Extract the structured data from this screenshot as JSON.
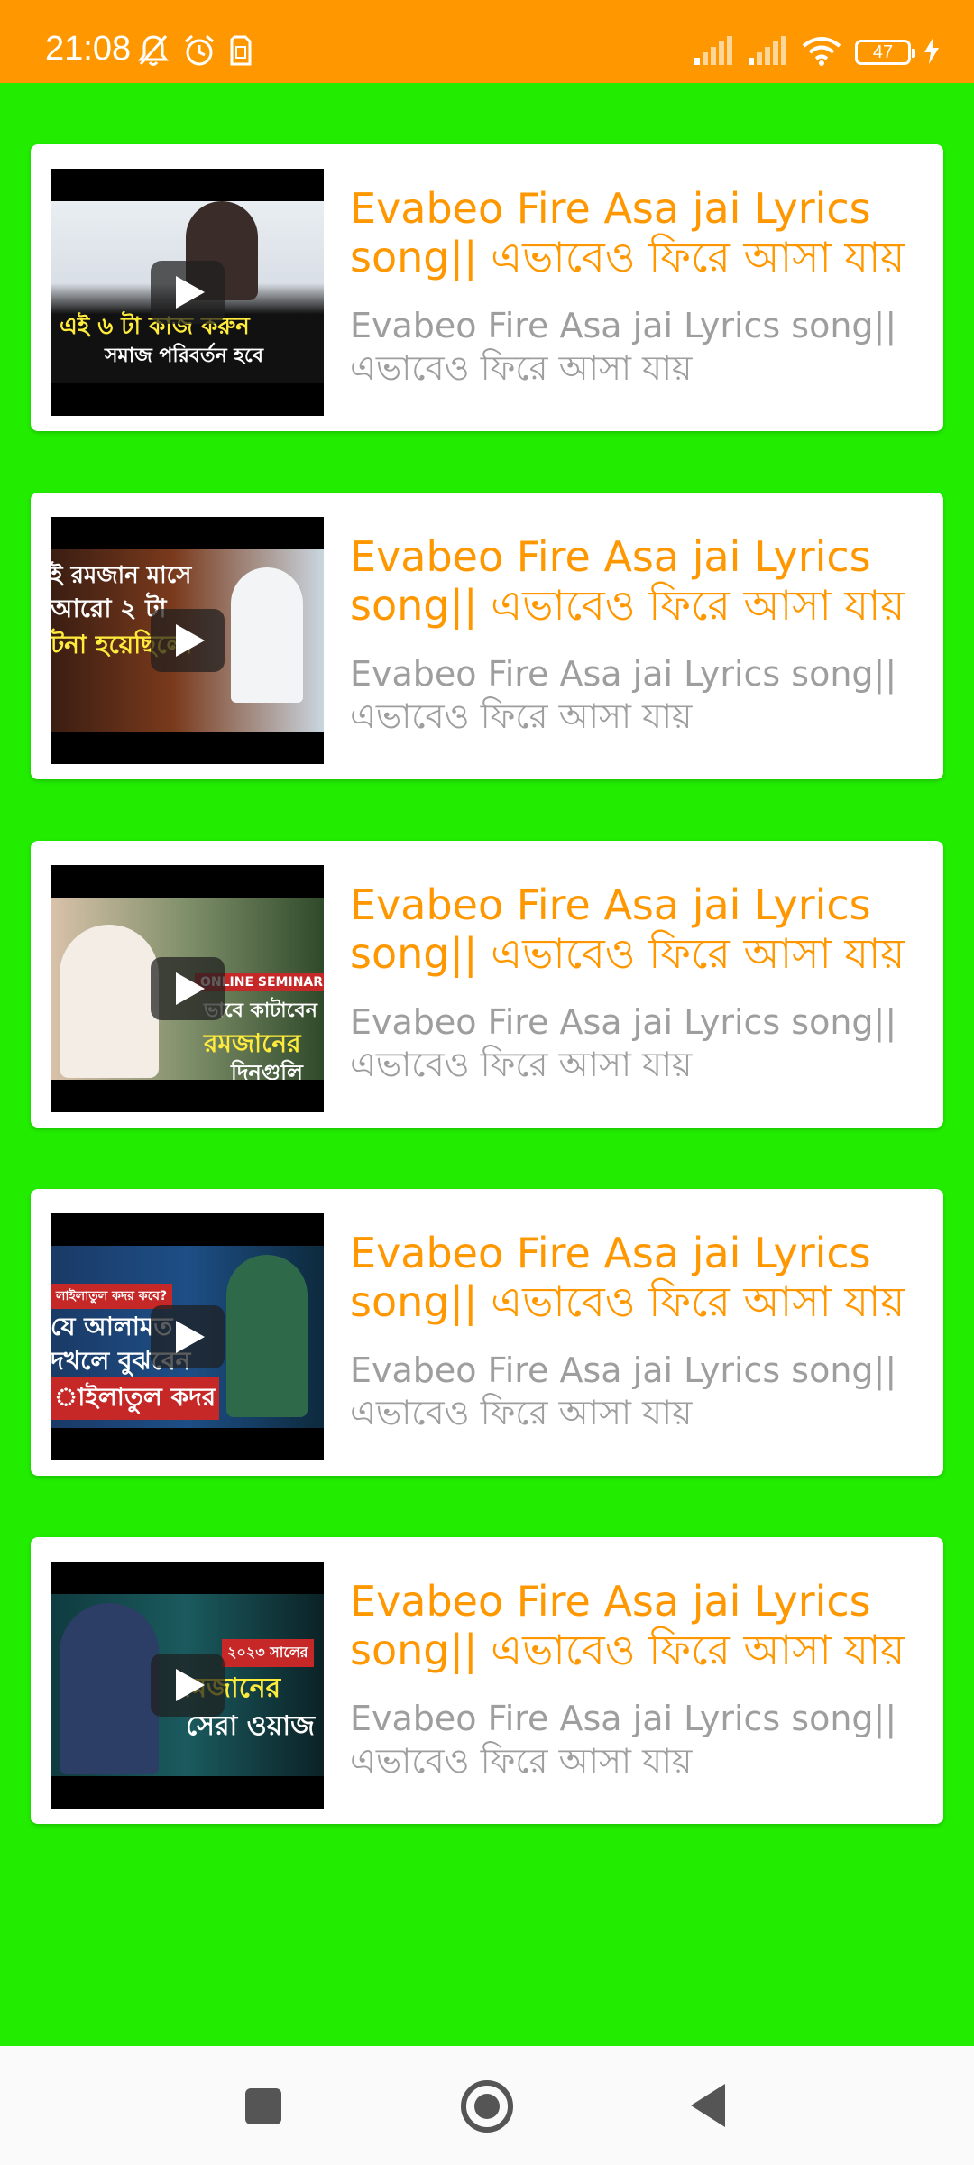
{
  "status_bar": {
    "time": "21:08",
    "battery_level": "47",
    "left_icons": [
      "muted-bell-icon",
      "alarm-clock-icon",
      "sim-icon"
    ],
    "right_icons": [
      "signal-icon",
      "signal-icon",
      "wifi-icon",
      "battery-icon",
      "charging-bolt-icon"
    ]
  },
  "colors": {
    "status_bar": "#ff9800",
    "background": "#22ec00",
    "title_text": "#ff9800",
    "subtitle_text": "#9e9e9e"
  },
  "list": {
    "items": [
      {
        "title": "Evabeo Fire Asa jai Lyrics song|| এভাবেও ফিরে আসা যায়",
        "subtitle": "Evabeo Fire Asa jai Lyrics song|| এভাবেও ফিরে আসা যায়",
        "thumbnail_lines": [
          "এই ৬ টা কাজ করুন",
          "সমাজ পরিবর্তন হবে"
        ]
      },
      {
        "title": "Evabeo Fire Asa jai Lyrics song|| এভাবেও ফিরে আসা যায়",
        "subtitle": "Evabeo Fire Asa jai Lyrics song|| এভাবেও ফিরে আসা যায়",
        "thumbnail_lines": [
          "ই রমজান মাসে",
          "আরো ২ টা",
          "টনা হয়েছিলো"
        ]
      },
      {
        "title": "Evabeo Fire Asa jai Lyrics song|| এভাবেও ফিরে আসা যায়",
        "subtitle": "Evabeo Fire Asa jai Lyrics song|| এভাবেও ফিরে আসা যায়",
        "thumbnail_lines": [
          "ONLINE SEMINAR",
          "ভাবে কাটাবেন",
          "রমজানের",
          "দিনগুলি"
        ]
      },
      {
        "title": "Evabeo Fire Asa jai Lyrics song|| এভাবেও ফিরে আসা যায়",
        "subtitle": "Evabeo Fire Asa jai Lyrics song|| এভাবেও ফিরে আসা যায়",
        "thumbnail_lines": [
          "লাইলাতুল কদর কবে?",
          "যে আলামত",
          "দখলে বুঝবেন",
          "াইলাতুল কদর"
        ]
      },
      {
        "title": "Evabeo Fire Asa jai Lyrics song|| এভাবেও ফিরে আসা যায়",
        "subtitle": "Evabeo Fire Asa jai Lyrics song|| এভাবেও ফিরে আসা যায়",
        "thumbnail_lines": [
          "২০২৩ সালের",
          "রমজানের",
          "সেরা ওয়াজ"
        ]
      }
    ]
  },
  "nav_bar": {
    "buttons": [
      "recents-button",
      "home-button",
      "back-button"
    ]
  }
}
